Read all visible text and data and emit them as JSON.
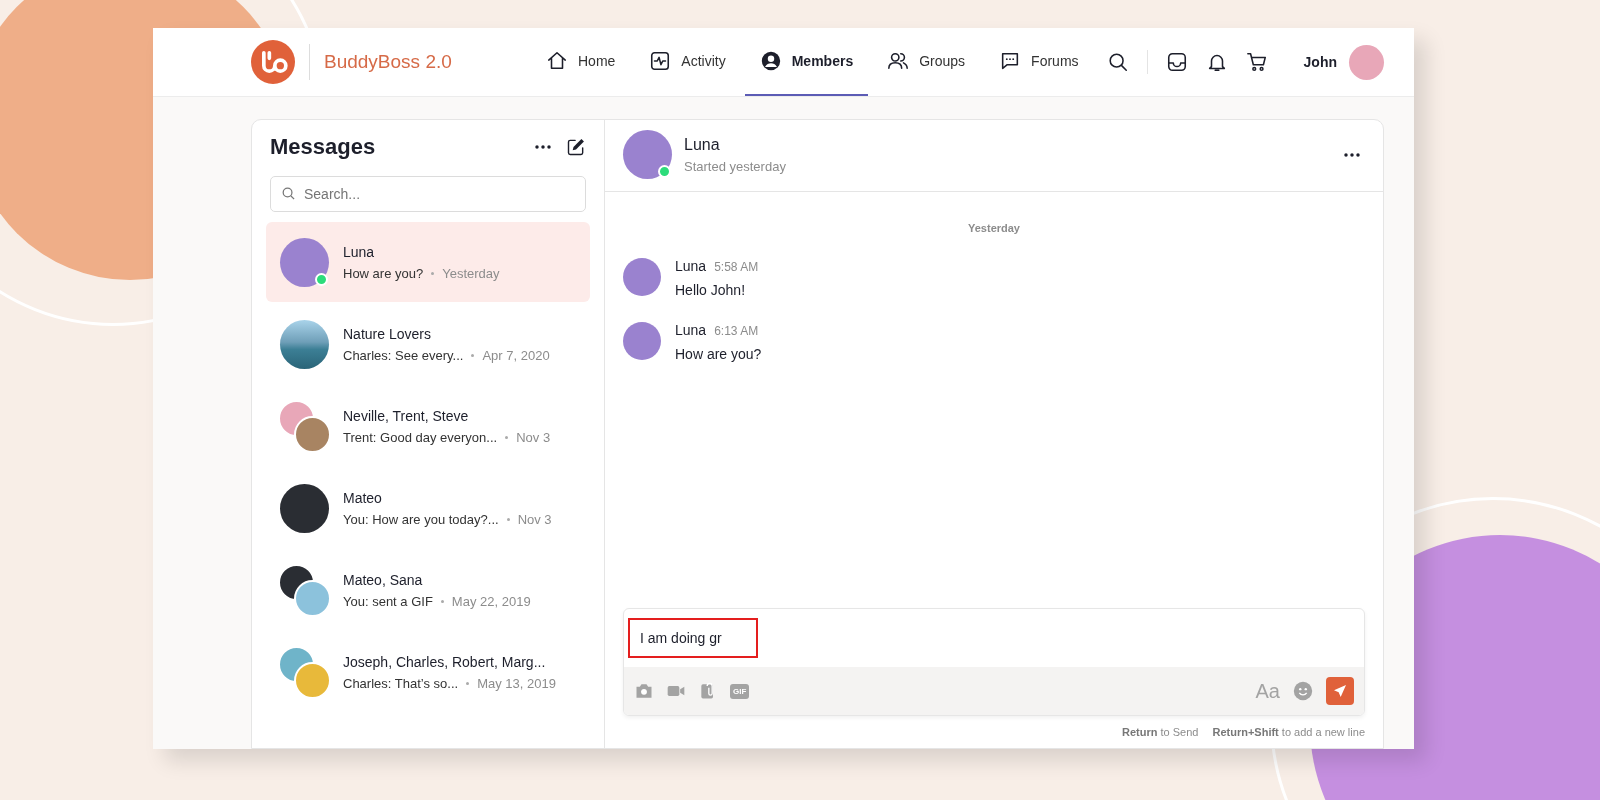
{
  "header": {
    "brand": "BuddyBoss 2.0",
    "nav": [
      {
        "label": "Home",
        "selected": false
      },
      {
        "label": "Activity",
        "selected": false
      },
      {
        "label": "Members",
        "selected": true
      },
      {
        "label": "Groups",
        "selected": false
      },
      {
        "label": "Forums",
        "selected": false
      }
    ],
    "user": "John"
  },
  "sidebar": {
    "title": "Messages",
    "search": {
      "placeholder": "Search..."
    },
    "threads": [
      {
        "name": "Luna",
        "preview": "How are you?",
        "date": "Yesterday",
        "selected": true,
        "online": true,
        "kind": "single"
      },
      {
        "name": "Nature Lovers",
        "preview": "Charles: See every...",
        "date": "Apr 7, 2020",
        "selected": false,
        "online": false,
        "kind": "photo"
      },
      {
        "name": "Neville, Trent, Steve",
        "preview": "Trent: Good day everyon...",
        "date": "Nov 3",
        "selected": false,
        "online": false,
        "kind": "pair"
      },
      {
        "name": "Mateo",
        "preview": "You: How are you today?...",
        "date": "Nov 3",
        "selected": false,
        "online": false,
        "kind": "single"
      },
      {
        "name": "Mateo, Sana",
        "preview": "You: sent a GIF",
        "date": "May 22, 2019",
        "selected": false,
        "online": false,
        "kind": "pair"
      },
      {
        "name": "Joseph, Charles, Robert, Marg...",
        "preview": "Charles: That’s so...",
        "date": "May 13, 2019",
        "selected": false,
        "online": false,
        "kind": "pair"
      }
    ]
  },
  "conversation": {
    "name": "Luna",
    "subtitle": "Started yesterday",
    "online": true,
    "day": "Yesterday",
    "messages": [
      {
        "author": "Luna",
        "time": "5:58 AM",
        "text": "Hello John!"
      },
      {
        "author": "Luna",
        "time": "6:13 AM",
        "text": "How are you?"
      }
    ],
    "composer": {
      "value": "I am doing gr",
      "highlighted": true,
      "format_label": "Aa",
      "gif_label": "GIF"
    },
    "hint": [
      "**Return** to Send",
      "**Return+Shift** to add a new line"
    ]
  }
}
